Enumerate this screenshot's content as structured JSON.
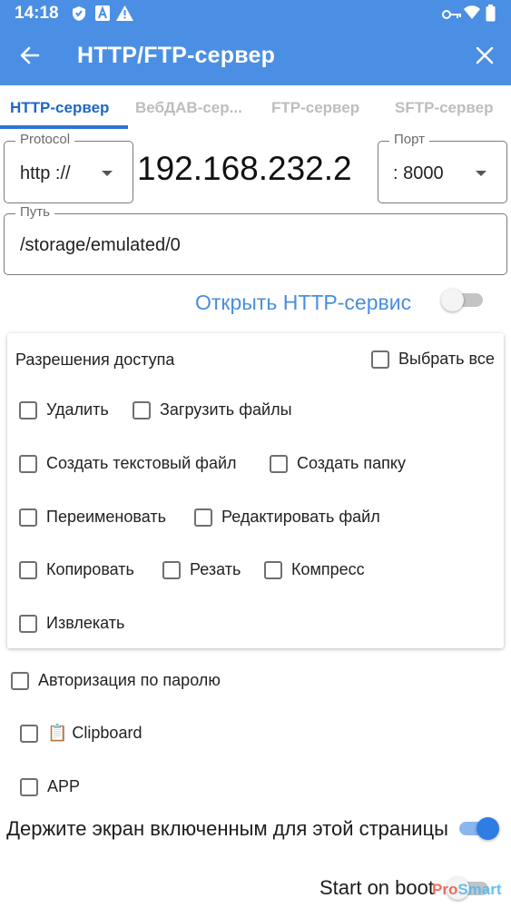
{
  "status_bar": {
    "time": "14:18",
    "left_icons": [
      "shield-icon",
      "a-icon",
      "warning-icon"
    ],
    "right_icons": [
      "key-icon",
      "wifi-icon",
      "battery-icon"
    ]
  },
  "app_bar": {
    "title": "HTTP/FTP-сервер",
    "background": "#4b8fe4"
  },
  "tabs": [
    {
      "label": "HTTP-сервер",
      "active": true
    },
    {
      "label": "ВебДАВ-сер...",
      "active": false
    },
    {
      "label": "FTP-сервер",
      "active": false
    },
    {
      "label": "SFTP-сервер",
      "active": false
    }
  ],
  "protocol": {
    "label": "Protocol",
    "value": "http ://"
  },
  "ip_address": "192.168.232.2",
  "port": {
    "label": "Порт",
    "value": ": 8000"
  },
  "path": {
    "label": "Путь",
    "value": "/storage/emulated/0"
  },
  "open_service": {
    "label": "Открыть HTTP-сервис",
    "enabled": false
  },
  "permissions": {
    "title": "Разрешения доступа",
    "select_all": {
      "label": "Выбрать все",
      "checked": false
    },
    "items": [
      {
        "label": "Удалить",
        "checked": false
      },
      {
        "label": "Загрузить файлы",
        "checked": false
      },
      {
        "label": "Создать текстовый файл",
        "checked": false
      },
      {
        "label": "Создать папку",
        "checked": false
      },
      {
        "label": "Переименовать",
        "checked": false
      },
      {
        "label": "Редактировать файл",
        "checked": false
      },
      {
        "label": "Копировать",
        "checked": false
      },
      {
        "label": "Резать",
        "checked": false
      },
      {
        "label": "Компресс",
        "checked": false
      },
      {
        "label": "Извлекать",
        "checked": false
      }
    ]
  },
  "password_auth": {
    "label": "Авторизация по паролю",
    "checked": false
  },
  "clipboard": {
    "label": "📋 Clipboard",
    "checked": false
  },
  "app_option": {
    "label": "APP",
    "checked": false
  },
  "keep_screen_on": {
    "label": "Держите экран включенным для этой страницы",
    "enabled": true
  },
  "start_on_boot": {
    "label": "Start on boot",
    "enabled": false
  },
  "watermark": {
    "part1": "Pro",
    "part2": "Smart"
  },
  "colors": {
    "accent": "#2f74d0",
    "link_blue": "#4a8ee0",
    "inactive_tab": "#bdbdbd"
  }
}
